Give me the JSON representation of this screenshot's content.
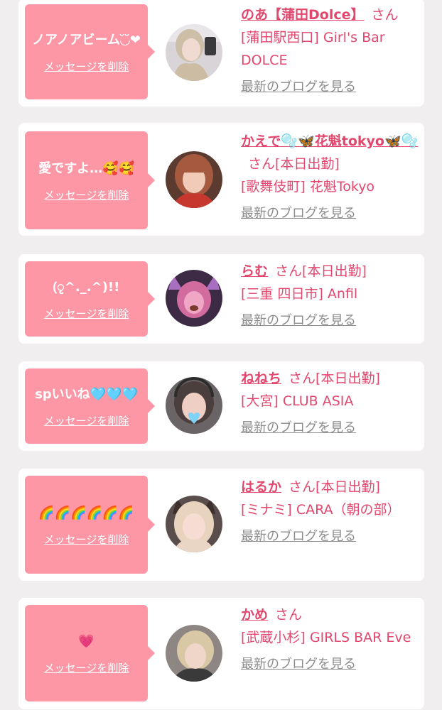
{
  "delete_label": "メッセージを削除",
  "blog_label": "最新のブログを見る",
  "san_label": "さん",
  "colors": {
    "bubble": "#fd96a5",
    "accent": "#e2476e",
    "link_gray": "#8c8c8c",
    "background": "#f0eeef"
  },
  "messages": [
    {
      "text": "ノアノアビーム◟̆◞̆❤︎",
      "name": "のあ【蒲田Dolce】",
      "status": "",
      "shop": "[蒲田駅西口] Girl's Bar DOLCE",
      "avatar_icon": "avatar-photo"
    },
    {
      "text": "愛ですよ…🥰🥰",
      "name": "かえで🫧🦋花魁tokyo🦋🫧",
      "status": "[本日出勤]",
      "shop": "[歌舞伎町] 花魁Tokyo",
      "avatar_icon": "avatar-photo"
    },
    {
      "text": "(ृ^._.^)!!",
      "name": "らむ",
      "status": "[本日出勤]",
      "shop": "[三重 四日市] Anfil",
      "avatar_icon": "avatar-photo"
    },
    {
      "text": "spいいね🩵🩵🩵",
      "name": "ねねち",
      "status": "[本日出勤]",
      "shop": "[大宮] CLUB ASIA",
      "avatar_icon": "avatar-photo"
    },
    {
      "text": "🌈🌈🌈🌈🌈🌈",
      "name": "はるか",
      "status": "[本日出勤]",
      "shop": "[ミナミ] CARA（朝の部）",
      "avatar_icon": "avatar-photo"
    },
    {
      "text": "💗",
      "name": "かめ",
      "status": "",
      "shop": "[武蔵小杉] GIRLS BAR Eve",
      "avatar_icon": "avatar-photo"
    }
  ]
}
